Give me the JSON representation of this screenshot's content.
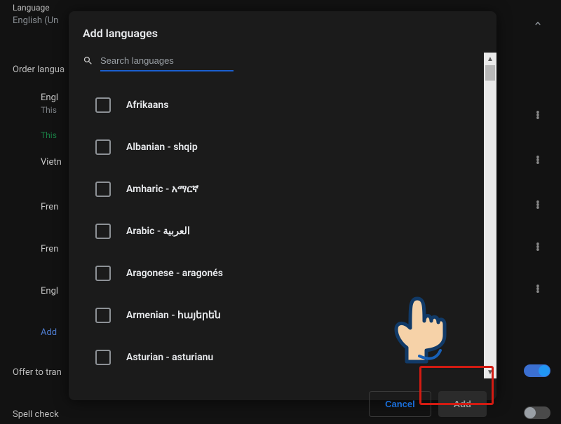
{
  "background": {
    "language_label": "Language",
    "language_sub": "English (Un",
    "order_label": "Order langua",
    "items": {
      "english": "Engl",
      "english_sub": "This",
      "english_sub2": "This",
      "viet": "Vietn",
      "fren1": "Fren",
      "fren2": "Fren",
      "engl": "Engl",
      "add": "Add",
      "offer": "Offer to tran",
      "spell": "Spell check"
    }
  },
  "modal": {
    "title": "Add languages",
    "search_placeholder": "Search languages",
    "languages": [
      {
        "label": "Afrikaans"
      },
      {
        "label": "Albanian - shqip"
      },
      {
        "label": "Amharic - አማርኛ"
      },
      {
        "label": "Arabic - العربية"
      },
      {
        "label": "Aragonese - aragonés"
      },
      {
        "label": "Armenian - հայերեն"
      },
      {
        "label": "Asturian - asturianu"
      }
    ],
    "cancel": "Cancel",
    "add": "Add"
  }
}
